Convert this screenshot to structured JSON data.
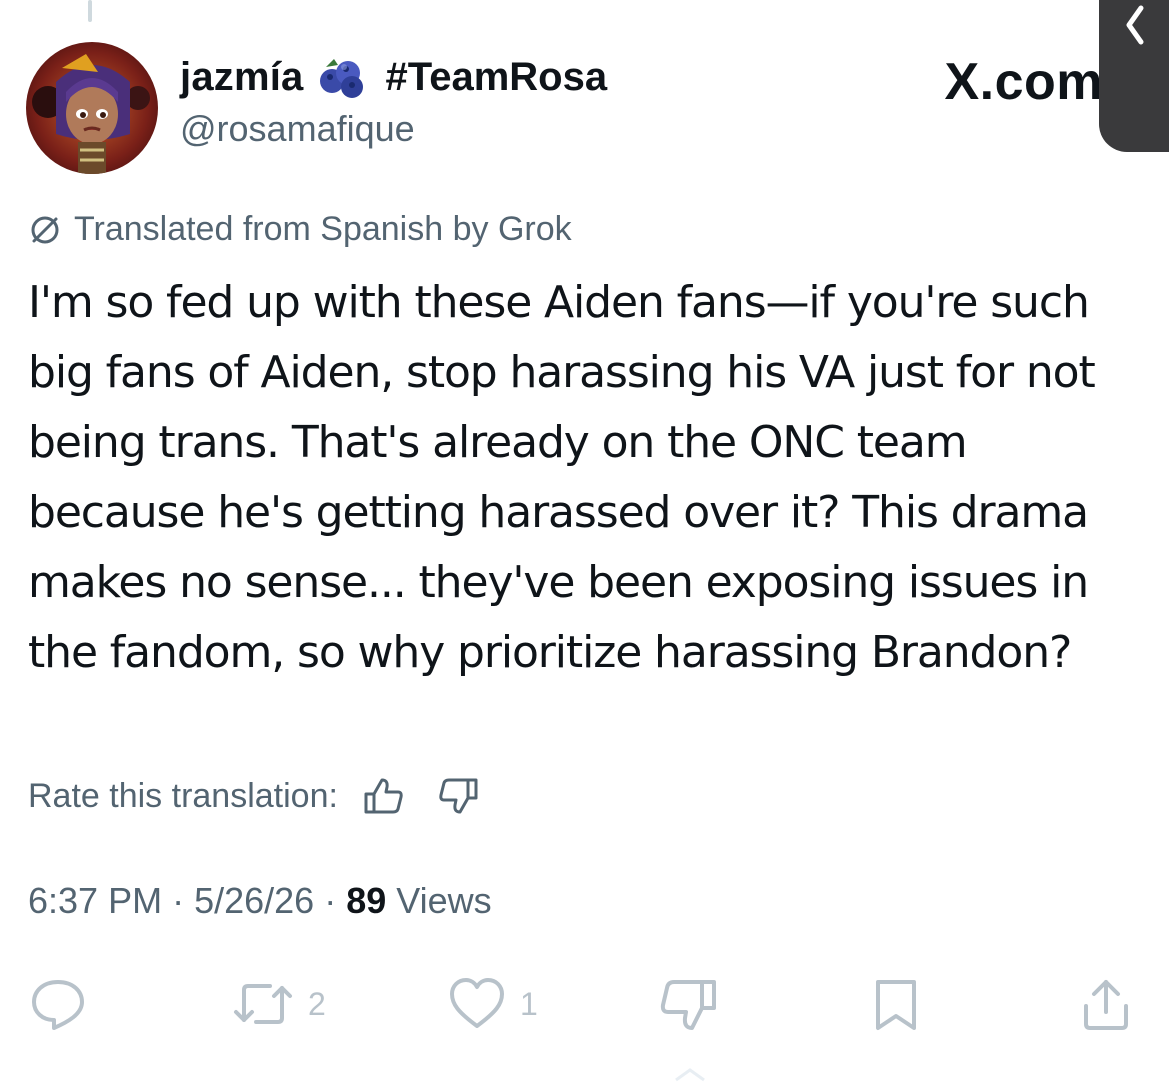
{
  "author": {
    "display_name": "jazmía",
    "badge_icon": "blueberries-emoji-icon",
    "hashtag": "#TeamRosa",
    "handle": "@rosamafique"
  },
  "brand": "X.com",
  "translation": {
    "notice": "Translated from Spanish by Grok",
    "rate_label": "Rate this translation:"
  },
  "tweet": {
    "text": "I'm so fed up with these Aiden fans—if you're such big fans of Aiden, stop harassing his VA just for not being trans. That's already on the ONC team because he's getting harassed over it? This drama makes no sense... they've been exposing issues in the fandom, so why prioritize harassing Brandon?",
    "time": "6:37 PM",
    "date": "5/26/26",
    "views_count": "89",
    "views_label": "Views"
  },
  "actions": {
    "reposts": "2",
    "likes": "1"
  },
  "colors": {
    "text": "#0f1419",
    "secondary": "#536471",
    "action_gray": "#b8c2ca",
    "side_tab": "#3a3a3c"
  }
}
